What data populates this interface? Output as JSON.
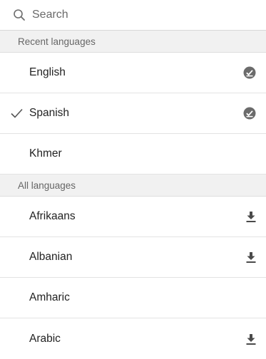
{
  "search": {
    "placeholder": "Search"
  },
  "recent": {
    "header": "Recent languages",
    "items": [
      {
        "label": "English",
        "selected": false,
        "status": "downloaded-icon"
      },
      {
        "label": "Spanish",
        "selected": true,
        "status": "downloaded-icon"
      },
      {
        "label": "Khmer",
        "selected": false,
        "status": ""
      }
    ]
  },
  "all": {
    "header": "All languages",
    "items": [
      {
        "label": "Afrikaans",
        "status": "download-icon"
      },
      {
        "label": "Albanian",
        "status": "download-icon"
      },
      {
        "label": "Amharic",
        "status": ""
      },
      {
        "label": "Arabic",
        "status": "download-icon"
      }
    ]
  }
}
